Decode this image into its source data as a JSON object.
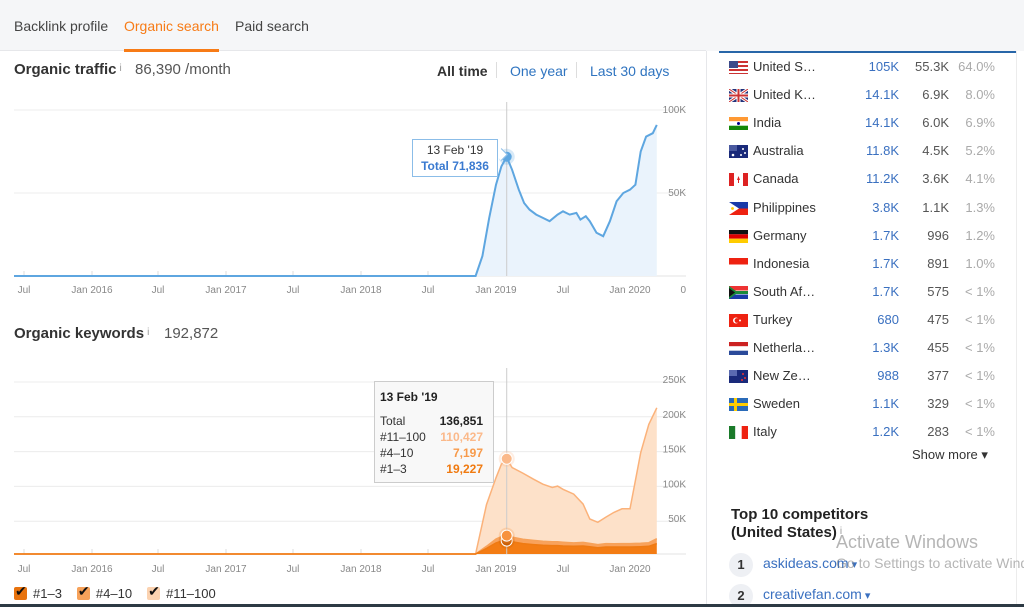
{
  "tabs": [
    {
      "label": "Backlink profile",
      "active": false
    },
    {
      "label": "Organic search",
      "active": true
    },
    {
      "label": "Paid search",
      "active": false
    }
  ],
  "traffic": {
    "title": "Organic traffic",
    "info": "i",
    "value": "86,390 /month",
    "ranges": [
      "All time",
      "One year",
      "Last 30 days"
    ],
    "active_range": "All time",
    "tooltip": {
      "date": "13 Feb '19",
      "total": "Total 71,836"
    }
  },
  "keywords": {
    "title": "Organic keywords",
    "info": "i",
    "value": "192,872",
    "tooltip": {
      "date": "13 Feb '19",
      "rows": [
        {
          "label": "Total",
          "value": "136,851",
          "color": "#222222"
        },
        {
          "label": "#11–100",
          "value": "110,427",
          "color": "#fbb98a"
        },
        {
          "label": "#4–10",
          "value": "7,197",
          "color": "#f79a4a"
        },
        {
          "label": "#1–3",
          "value": "19,227",
          "color": "#f07a10"
        }
      ]
    },
    "legend": [
      {
        "label": "#1–3",
        "color": "#e8730e",
        "checked": true
      },
      {
        "label": "#4–10",
        "color": "#f7a25a",
        "checked": true
      },
      {
        "label": "#11–100",
        "color": "#fbd2b0",
        "checked": true
      }
    ]
  },
  "chart_data": [
    {
      "type": "area",
      "title": "Organic traffic",
      "xlabel": "",
      "ylabel": "",
      "x_ticks": [
        "Jul",
        "Jan 2016",
        "Jul",
        "Jan 2017",
        "Jul",
        "Jan 2018",
        "Jul",
        "Jan 2019",
        "Jul",
        "Jan 2020"
      ],
      "x_range": [
        2015.5,
        2020.25
      ],
      "y_ticks": [
        "100K",
        "50K",
        "0"
      ],
      "ylim": [
        0,
        100000
      ],
      "grid": true,
      "color": "#5ea6e0",
      "series": [
        {
          "name": "Total",
          "x": [
            2015.42,
            2018.85,
            2018.9,
            2018.95,
            2019.0,
            2019.04,
            2019.08,
            2019.12,
            2019.17,
            2019.21,
            2019.25,
            2019.3,
            2019.35,
            2019.4,
            2019.46,
            2019.5,
            2019.55,
            2019.6,
            2019.63,
            2019.67,
            2019.7,
            2019.75,
            2019.8,
            2019.85,
            2019.9,
            2019.95,
            2020.0,
            2020.04,
            2020.08,
            2020.12,
            2020.17,
            2020.2
          ],
          "values": [
            0,
            0,
            12000,
            35000,
            55000,
            66000,
            71836,
            64000,
            52000,
            44000,
            40000,
            37000,
            35000,
            33000,
            37000,
            39000,
            37000,
            38000,
            34000,
            36000,
            33000,
            26000,
            24000,
            33000,
            45000,
            50000,
            52000,
            55000,
            75000,
            84000,
            86000,
            91000
          ]
        }
      ],
      "highlight": {
        "x": "13 Feb '19",
        "value": 71836
      }
    },
    {
      "type": "area",
      "stacked": true,
      "title": "Organic keywords",
      "xlabel": "",
      "ylabel": "",
      "x_ticks": [
        "Jul",
        "Jan 2016",
        "Jul",
        "Jan 2017",
        "Jul",
        "Jan 2018",
        "Jul",
        "Jan 2019",
        "Jul",
        "Jan 2020"
      ],
      "x_range": [
        2015.5,
        2020.25
      ],
      "y_ticks": [
        "250K",
        "200K",
        "150K",
        "100K",
        "50K"
      ],
      "ylim": [
        0,
        250000
      ],
      "grid": true,
      "x": [
        2015.42,
        2018.85,
        2018.93,
        2019.0,
        2019.04,
        2019.08,
        2019.12,
        2019.2,
        2019.28,
        2019.35,
        2019.42,
        2019.46,
        2019.5,
        2019.58,
        2019.65,
        2019.7,
        2019.76,
        2019.82,
        2019.88,
        2019.94,
        2020.0,
        2020.08,
        2020.14,
        2020.2
      ],
      "series": [
        {
          "name": "#1–3",
          "color": "#f07a10",
          "values": [
            0,
            0,
            8000,
            16000,
            18500,
            19227,
            17500,
            15000,
            13500,
            12500,
            12000,
            12000,
            11500,
            11000,
            11500,
            10500,
            9000,
            10000,
            10000,
            10000,
            10000,
            10500,
            11000,
            15000
          ]
        },
        {
          "name": "#4–10",
          "color": "#f79a4a",
          "values": [
            0,
            0,
            3000,
            5500,
            6500,
            7197,
            6800,
            6200,
            6000,
            5800,
            5600,
            5500,
            5400,
            5000,
            5200,
            4800,
            4500,
            5000,
            4800,
            5000,
            5000,
            5000,
            5200,
            7000
          ]
        },
        {
          "name": "#11–100",
          "color": "#fbd2b0",
          "values": [
            0,
            0,
            60000,
            88000,
            104000,
            110427,
            100000,
            95000,
            88000,
            82000,
            78000,
            80000,
            76000,
            70000,
            55000,
            35000,
            32000,
            38000,
            45000,
            50000,
            50000,
            130000,
            170000,
            188000
          ]
        }
      ],
      "highlight": {
        "x": "13 Feb '19",
        "total": 136851
      }
    }
  ],
  "countries": [
    {
      "name": "United S…",
      "flag": "us",
      "traffic": "105K",
      "keywords": "55.3K",
      "share": "64.0%"
    },
    {
      "name": "United K…",
      "flag": "uk",
      "traffic": "14.1K",
      "keywords": "6.9K",
      "share": "8.0%"
    },
    {
      "name": "India",
      "flag": "in",
      "traffic": "14.1K",
      "keywords": "6.0K",
      "share": "6.9%"
    },
    {
      "name": "Australia",
      "flag": "au",
      "traffic": "11.8K",
      "keywords": "4.5K",
      "share": "5.2%"
    },
    {
      "name": "Canada",
      "flag": "ca",
      "traffic": "11.2K",
      "keywords": "3.6K",
      "share": "4.1%"
    },
    {
      "name": "Philippines",
      "flag": "ph",
      "traffic": "3.8K",
      "keywords": "1.1K",
      "share": "1.3%"
    },
    {
      "name": "Germany",
      "flag": "de",
      "traffic": "1.7K",
      "keywords": "996",
      "share": "1.2%"
    },
    {
      "name": "Indonesia",
      "flag": "id",
      "traffic": "1.7K",
      "keywords": "891",
      "share": "1.0%"
    },
    {
      "name": "South Af…",
      "flag": "za",
      "traffic": "1.7K",
      "keywords": "575",
      "share": "< 1%"
    },
    {
      "name": "Turkey",
      "flag": "tr",
      "traffic": "680",
      "keywords": "475",
      "share": "< 1%"
    },
    {
      "name": "Netherla…",
      "flag": "nl",
      "traffic": "1.3K",
      "keywords": "455",
      "share": "< 1%"
    },
    {
      "name": "New Ze…",
      "flag": "nz",
      "traffic": "988",
      "keywords": "377",
      "share": "< 1%"
    },
    {
      "name": "Sweden",
      "flag": "se",
      "traffic": "1.1K",
      "keywords": "329",
      "share": "< 1%"
    },
    {
      "name": "Italy",
      "flag": "it",
      "traffic": "1.2K",
      "keywords": "283",
      "share": "< 1%"
    }
  ],
  "show_more": "Show more ▾",
  "competitors": {
    "title_line1": "Top 10 competitors",
    "title_line2": "(United States)",
    "info": "i",
    "items": [
      {
        "rank": "1",
        "domain": "askideas.com"
      },
      {
        "rank": "2",
        "domain": "creativefan.com"
      }
    ]
  },
  "watermark": {
    "line1": "Activate Windows",
    "line2": "Go to Settings to activate Windows."
  }
}
